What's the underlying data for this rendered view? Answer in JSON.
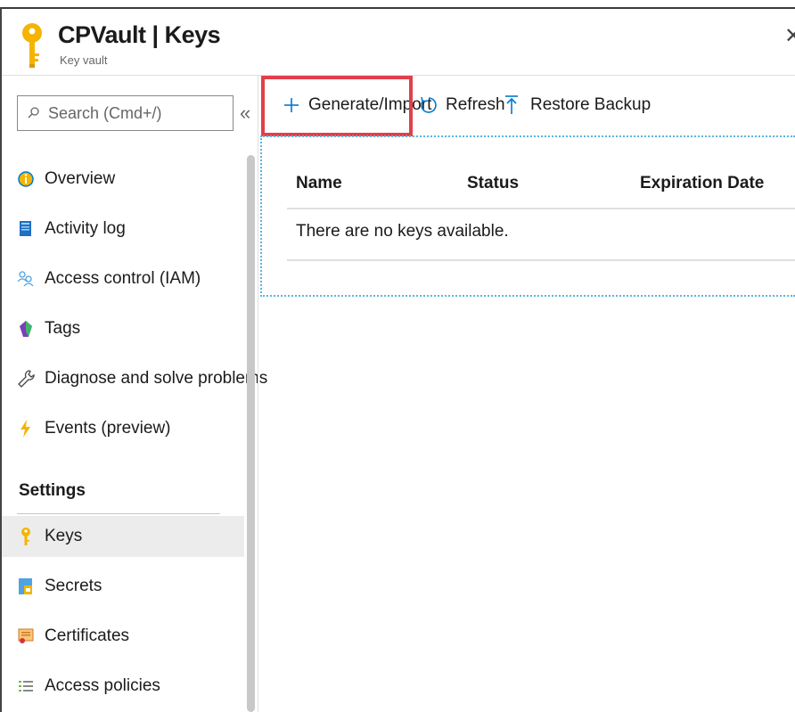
{
  "header": {
    "title": "CPVault | Keys",
    "subtitle": "Key vault",
    "close_symbol": "✕"
  },
  "search": {
    "placeholder": "Search (Cmd+/)",
    "collapse_symbol": "«"
  },
  "sidebar": {
    "items": [
      {
        "label": "Overview",
        "icon": "overview-icon"
      },
      {
        "label": "Activity log",
        "icon": "activity-log-icon"
      },
      {
        "label": "Access control (IAM)",
        "icon": "iam-icon"
      },
      {
        "label": "Tags",
        "icon": "tag-icon"
      },
      {
        "label": "Diagnose and solve problems",
        "icon": "wrench-icon"
      },
      {
        "label": "Events (preview)",
        "icon": "lightning-icon"
      }
    ],
    "section_settings": "Settings",
    "settings_items": [
      {
        "label": "Keys",
        "icon": "key-icon",
        "selected": true
      },
      {
        "label": "Secrets",
        "icon": "secret-icon"
      },
      {
        "label": "Certificates",
        "icon": "certificate-icon"
      },
      {
        "label": "Access policies",
        "icon": "access-policies-icon"
      }
    ]
  },
  "toolbar": {
    "generate_label": "Generate/Import",
    "refresh_label": "Refresh",
    "restore_label": "Restore Backup"
  },
  "table": {
    "columns": [
      "Name",
      "Status",
      "Expiration Date"
    ],
    "empty_message": "There are no keys available."
  },
  "colors": {
    "highlight": "#e0404a",
    "key_yellow": "#f4b400",
    "accent_blue": "#0078d4",
    "dotted_border": "#5ab4e0"
  }
}
